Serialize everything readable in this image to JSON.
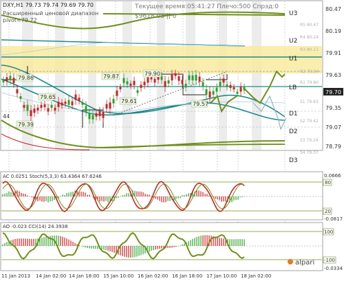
{
  "header": {
    "symbol_line": "DXY,H1  79.73 79.74 79.69 79.70",
    "indicator_line1": "Расширенный ценовой диапазон",
    "indicator_line2": "pivot=79.72",
    "server_time": "Текущее время:05:41:27 Плечо:500 Спрэд:0",
    "balance_line": "$9618.03  ||  0"
  },
  "price_axis": {
    "ticks": [
      "80.47",
      "80.19",
      "79.91",
      "79.63",
      "79.35",
      "79.07",
      "78.79"
    ],
    "levels": [
      "U3",
      "U2",
      "U1",
      "LB",
      "D1",
      "D2",
      "D3"
    ],
    "current_price": "79.70",
    "right_labels": [
      "R5 80.47",
      "R4 80.24",
      "R3 80.11",
      "R2 79.94",
      "R1 79.80",
      "S1 79.63",
      "S2 79.42",
      "S3 79.24",
      "S4 79.07"
    ]
  },
  "price_labels": [
    "79.86",
    "79.65",
    "79.39",
    "79.87",
    "79.90",
    "79.61",
    "79.57",
    "44"
  ],
  "ac_panel": {
    "label": "AC 0.0251  Stoch(5,3,3) 63.4364 67.6246",
    "right_ticks": [
      "0.0666",
      "80",
      "20",
      "-0.0817"
    ]
  },
  "ao_panel": {
    "label": "AO -0.023  CCI(14) 24.3938",
    "right_ticks": [
      "100",
      "-100",
      "-0.0334"
    ]
  },
  "time_axis": [
    "11 Jan 2013",
    "14 Jan 02:00",
    "14 Jan 18:00",
    "15 Jan 10:00",
    "16 Jan 02:00",
    "16 Jan 18:00",
    "17 Jan 10:00",
    "18 Jan 02:00"
  ],
  "brand": "alpari",
  "colors": {
    "bull_candle": "#2ca02c",
    "bear_candle": "#cc2222",
    "pivot_band": "#f8eba0",
    "teal_line": "#1f8a8a",
    "olive_line": "#6f8f1a"
  }
}
